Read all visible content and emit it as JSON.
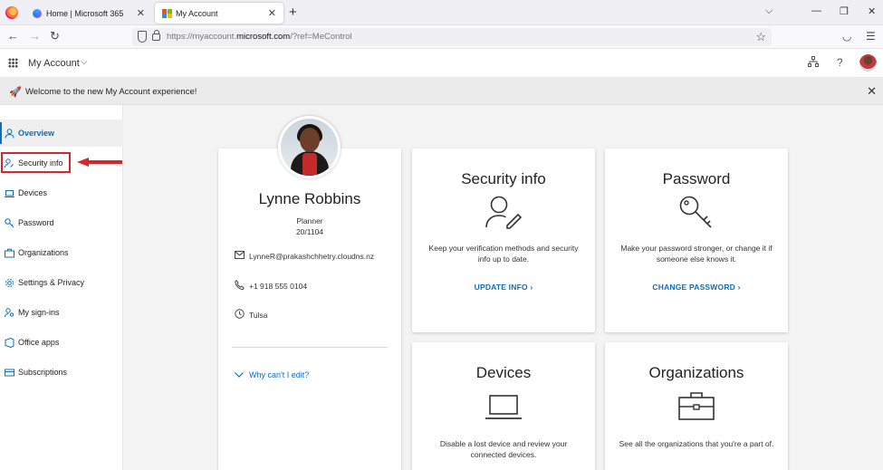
{
  "browser": {
    "tabs": [
      {
        "title": "Home | Microsoft 365",
        "active": false
      },
      {
        "title": "My Account",
        "active": true
      }
    ],
    "url_prefix": "https://myaccount.",
    "url_host": "microsoft.com",
    "url_suffix": "/?ref=MeControl"
  },
  "app": {
    "title": "My Account"
  },
  "banner": {
    "text": "Welcome to the new My Account experience!"
  },
  "sidebar": {
    "items": [
      {
        "label": "Overview",
        "icon": "person-icon"
      },
      {
        "label": "Security info",
        "icon": "person-key-icon"
      },
      {
        "label": "Devices",
        "icon": "laptop-icon"
      },
      {
        "label": "Password",
        "icon": "key-icon"
      },
      {
        "label": "Organizations",
        "icon": "briefcase-icon"
      },
      {
        "label": "Settings & Privacy",
        "icon": "gear-icon"
      },
      {
        "label": "My sign-ins",
        "icon": "person-key-icon"
      },
      {
        "label": "Office apps",
        "icon": "office-icon"
      },
      {
        "label": "Subscriptions",
        "icon": "card-icon"
      }
    ],
    "selected_index": 0,
    "highlighted_index": 1
  },
  "profile": {
    "name": "Lynne Robbins",
    "title": "Planner",
    "office": "20/1104",
    "email": "LynneR@prakashchhetry.cloudns.nz",
    "phone": "+1 918 555 0104",
    "location": "Tulsa",
    "why_cant_edit": "Why can't I edit?"
  },
  "tiles": {
    "security": {
      "title": "Security info",
      "description": "Keep your verification methods and security info up to date.",
      "link": "UPDATE INFO"
    },
    "password": {
      "title": "Password",
      "description": "Make your password stronger, or change it if someone else knows it.",
      "link": "CHANGE PASSWORD"
    },
    "devices": {
      "title": "Devices",
      "description": "Disable a lost device and review your connected devices."
    },
    "organizations": {
      "title": "Organizations",
      "description": "See all the organizations that you're a part of."
    }
  },
  "colors": {
    "accent": "#0f6cbd",
    "highlight": "#d6252b"
  }
}
